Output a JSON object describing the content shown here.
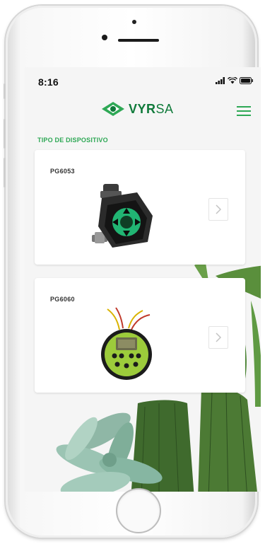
{
  "status_bar": {
    "time": "8:16",
    "signal_icon": "signal-bars-icon",
    "wifi_icon": "wifi-icon",
    "battery_icon": "battery-icon"
  },
  "header": {
    "logo_text_bold": "VYR",
    "logo_text_thin": "SA",
    "menu_icon": "hamburger-menu-icon"
  },
  "section_title": "TIPO DE DISPOSITIVO",
  "devices": [
    {
      "label": "PG6053",
      "image": "valve-timer-device-image",
      "arrow_icon": "chevron-right-icon"
    },
    {
      "label": "PG6060",
      "image": "irrigation-controller-device-image",
      "arrow_icon": "chevron-right-icon"
    }
  ],
  "colors": {
    "brand_green": "#0f7a3a",
    "accent_green": "#2ea855",
    "card_bg": "#ffffff",
    "screen_bg": "#f5f5f5"
  }
}
